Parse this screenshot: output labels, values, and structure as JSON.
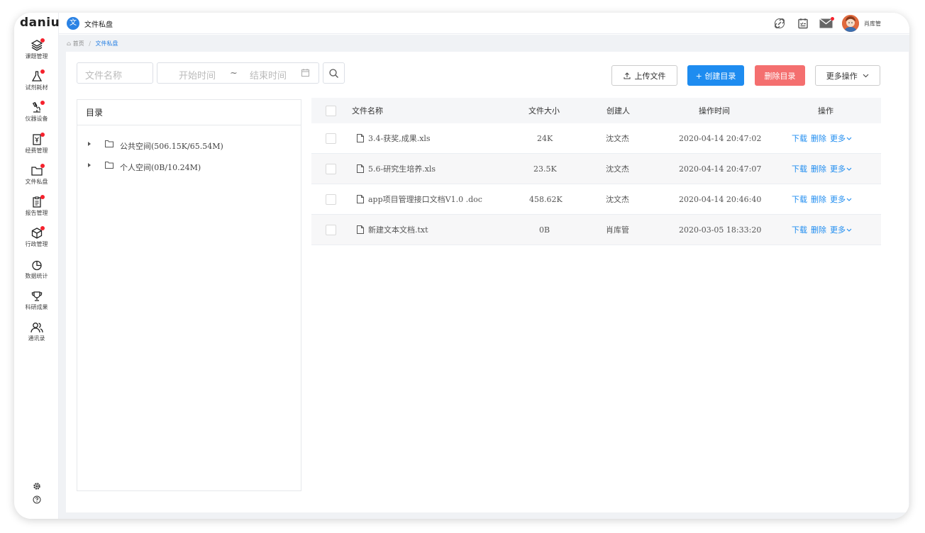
{
  "sidebar": {
    "logo": "daniu",
    "items": [
      {
        "label": "课题管理",
        "icon": "layers-icon",
        "dot": true
      },
      {
        "label": "试剂耗材",
        "icon": "flask-icon",
        "dot": true
      },
      {
        "label": "仪器设备",
        "icon": "microscope-icon",
        "dot": true
      },
      {
        "label": "经费管理",
        "icon": "receipt-icon",
        "dot": true
      },
      {
        "label": "文件私盘",
        "icon": "folder-icon",
        "dot": true
      },
      {
        "label": "报告管理",
        "icon": "clipboard-icon",
        "dot": true
      },
      {
        "label": "行政管理",
        "icon": "cube-icon",
        "dot": true
      },
      {
        "label": "数据统计",
        "icon": "pie-chart-icon",
        "dot": false
      },
      {
        "label": "科研成果",
        "icon": "trophy-icon",
        "dot": false
      },
      {
        "label": "通讯录",
        "icon": "contacts-icon",
        "dot": false
      }
    ]
  },
  "topbar": {
    "badge": "文",
    "title": "文件私盘",
    "user_name": "肖库管"
  },
  "breadcrumb": {
    "home": "首页",
    "separator": "/",
    "current": "文件私盘"
  },
  "filters": {
    "name_placeholder": "文件名称",
    "start_placeholder": "开始时间",
    "range_sep": "~",
    "end_placeholder": "结束时间"
  },
  "toolbar": {
    "upload": "上传文件",
    "create_dir": "+ 创建目录",
    "delete_dir": "删除目录",
    "more": "更多操作"
  },
  "tree": {
    "title": "目录",
    "nodes": [
      {
        "label": "公共空间(506.15K/65.54M)"
      },
      {
        "label": "个人空间(0B/10.24M)"
      }
    ]
  },
  "table": {
    "headers": {
      "name": "文件名称",
      "size": "文件大小",
      "creator": "创建人",
      "time": "操作时间",
      "actions": "操作"
    },
    "rows": [
      {
        "name": "3.4-获奖,成果.xls",
        "size": "24K",
        "creator": "沈文杰",
        "time": "2020-04-14 20:47:02"
      },
      {
        "name": "5.6-研究生培养.xls",
        "size": "23.5K",
        "creator": "沈文杰",
        "time": "2020-04-14 20:47:07"
      },
      {
        "name": "app项目管理接口文档V1.0 .doc",
        "size": "458.62K",
        "creator": "沈文杰",
        "time": "2020-04-14 20:46:40"
      },
      {
        "name": "新建文本文档.txt",
        "size": "0B",
        "creator": "肖库管",
        "time": "2020-03-05 18:33:20"
      }
    ],
    "action_labels": {
      "download": "下载",
      "delete": "删除",
      "more": "更多"
    }
  },
  "colors": {
    "primary": "#1e8cf0",
    "danger": "#f46f6f",
    "badge": "#f5222d"
  }
}
